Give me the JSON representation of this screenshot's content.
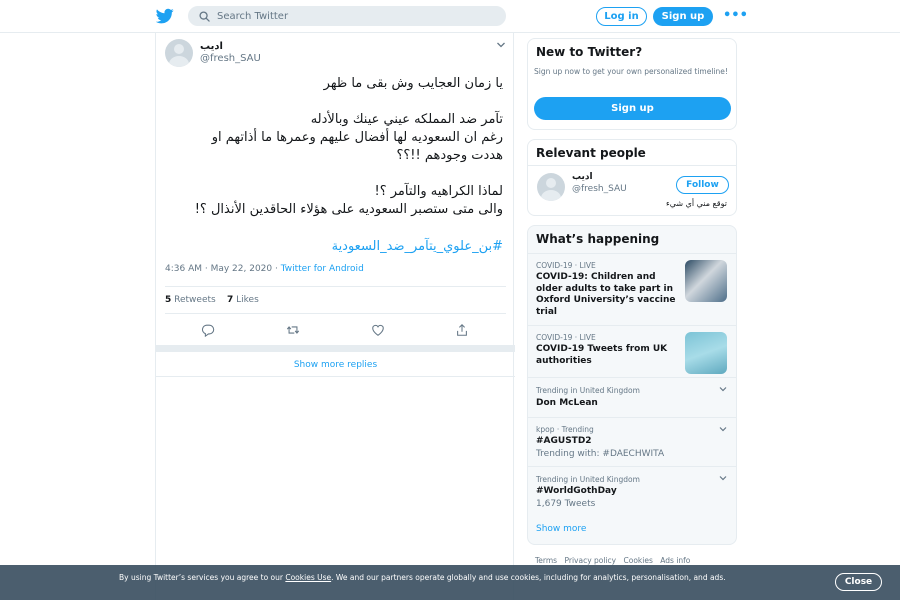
{
  "header": {
    "search_placeholder": "Search Twitter",
    "login_label": "Log in",
    "signup_label": "Sign up",
    "more_label": "•••"
  },
  "tweet": {
    "display_name": "اديب",
    "handle": "@fresh_SAU",
    "text_paragraphs": [
      [
        "يا زمان العجايب وش بقى ما ظهر"
      ],
      [
        "تآمر ضد المملكه عيني عينك وبالأدله",
        "رغم ان السعوديه لها أفضال عليهم وعمرها ما أذاتهم او",
        "هددت وجودهم !!؟؟"
      ],
      [
        "لماذا الكراهيه والتآمر ؟!",
        "والى متى ستصبر السعوديه على هؤلاء الحاقدين الأنذال ؟!"
      ]
    ],
    "hashtag": "#بن_علوي_يتآمر_ضد_السعودية",
    "time": "4:36 AM · May 22, 2020",
    "source": "Twitter for Android",
    "retweets_count": "5",
    "retweets_label": "Retweets",
    "likes_count": "7",
    "likes_label": "Likes",
    "show_more_replies": "Show more replies"
  },
  "sidebar": {
    "new_to_twitter": {
      "title": "New to Twitter?",
      "subtitle": "Sign up now to get your own personalized timeline!",
      "button": "Sign up"
    },
    "relevant_people": {
      "title": "Relevant people",
      "name": "اديب",
      "handle": "@fresh_SAU",
      "follow_label": "Follow",
      "bio": "توقع مني أي شيء"
    },
    "whats_happening": {
      "title": "What’s happening",
      "items": [
        {
          "context": "COVID-19 · LIVE",
          "title": "COVID-19: Children and older adults to take part in Oxford University’s vaccine trial"
        },
        {
          "context": "COVID-19 · LIVE",
          "title": "COVID-19 Tweets from UK authorities"
        },
        {
          "context": "Trending in United Kingdom",
          "title": "Don McLean"
        },
        {
          "context": "kpop · Trending",
          "title": "#AGUSTD2",
          "sub": "Trending with: #DAECHWITA"
        },
        {
          "context": "Trending in United Kingdom",
          "title": "#WorldGothDay",
          "sub": "1,679 Tweets"
        }
      ],
      "show_more": "Show more"
    },
    "footer_links": [
      "Terms",
      "Privacy policy",
      "Cookies",
      "Ads info"
    ]
  },
  "cookie_banner": {
    "text_before": "By using Twitter’s services you agree to our ",
    "link": "Cookies Use",
    "text_after": ". We and our partners operate globally and use cookies, including for analytics, personalisation, and ads.",
    "close_label": "Close"
  },
  "colors": {
    "accent": "#1da1f2",
    "text": "#14171a",
    "secondary": "#657786",
    "border": "#e6ecf0"
  }
}
